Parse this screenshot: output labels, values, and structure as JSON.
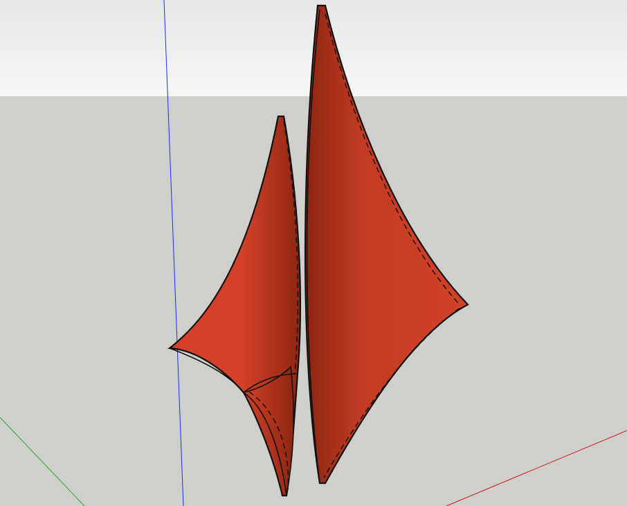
{
  "viewport": {
    "sky_color_top": "#e6e8e8",
    "sky_color_bottom": "#f5f6f6",
    "ground_color": "#cfcfcb"
  },
  "axes": {
    "blue_axis_color": "#1a2cff",
    "green_axis_color": "#27b02a",
    "red_axis_color": "#d8141b"
  },
  "model": {
    "face_color": "#d44128",
    "face_shade_color": "#8c2612",
    "edge_color": "#111111"
  }
}
